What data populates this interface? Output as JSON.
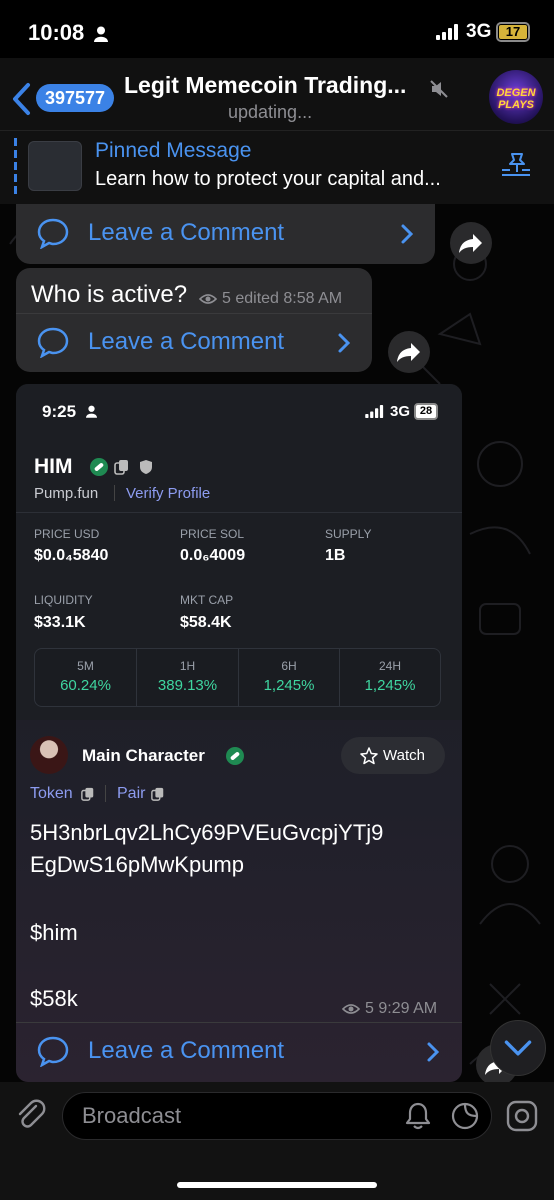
{
  "status_bar": {
    "time": "10:08",
    "network": "3G",
    "battery": "17"
  },
  "header": {
    "back_count": "397577",
    "title": "Legit Memecoin Trading...",
    "subtitle": "updating...",
    "avatar_text": "DEGEN PLAYS"
  },
  "pinned": {
    "title": "Pinned Message",
    "text": "Learn how to protect your capital and..."
  },
  "messages": [
    {
      "comment_label": "Leave a Comment"
    },
    {
      "text": "Who is active?",
      "views": "5",
      "edited": "edited",
      "time": "8:58 AM",
      "comment_label": "Leave a Comment"
    },
    {
      "comment_label": "Leave a Comment",
      "body_address_1": "5H3nbrLqv2LhCy69PVEuGvcpjYTj9",
      "body_address_2": "EgDwS16pMwKpump",
      "body_ticker": "$him",
      "body_mcap": "$58k",
      "views": "5",
      "time": "9:29 AM"
    }
  ],
  "screenshot": {
    "time": "9:25",
    "network": "3G",
    "battery": "28",
    "token_name": "HIM",
    "platform": "Pump.fun",
    "verify_label": "Verify Profile",
    "stats": [
      {
        "label": "PRICE USD",
        "value": "$0.0₄5840"
      },
      {
        "label": "PRICE SOL",
        "value": "0.0₆4009"
      },
      {
        "label": "SUPPLY",
        "value": "1B"
      },
      {
        "label": "LIQUIDITY",
        "value": "$33.1K"
      },
      {
        "label": "MKT CAP",
        "value": "$58.4K"
      }
    ],
    "changes": [
      {
        "period": "5M",
        "value": "60.24%"
      },
      {
        "period": "1H",
        "value": "389.13%"
      },
      {
        "period": "6H",
        "value": "1,245%"
      },
      {
        "period": "24H",
        "value": "1,245%"
      }
    ],
    "user_name": "Main Character",
    "watch_label": "Watch",
    "token_label": "Token",
    "pair_label": "Pair"
  },
  "composer": {
    "placeholder": "Broadcast"
  },
  "colors": {
    "accent": "#4a93f0",
    "badge": "#3b82e6",
    "green": "#3fd6a0",
    "bubble": "#2c2c2e"
  }
}
